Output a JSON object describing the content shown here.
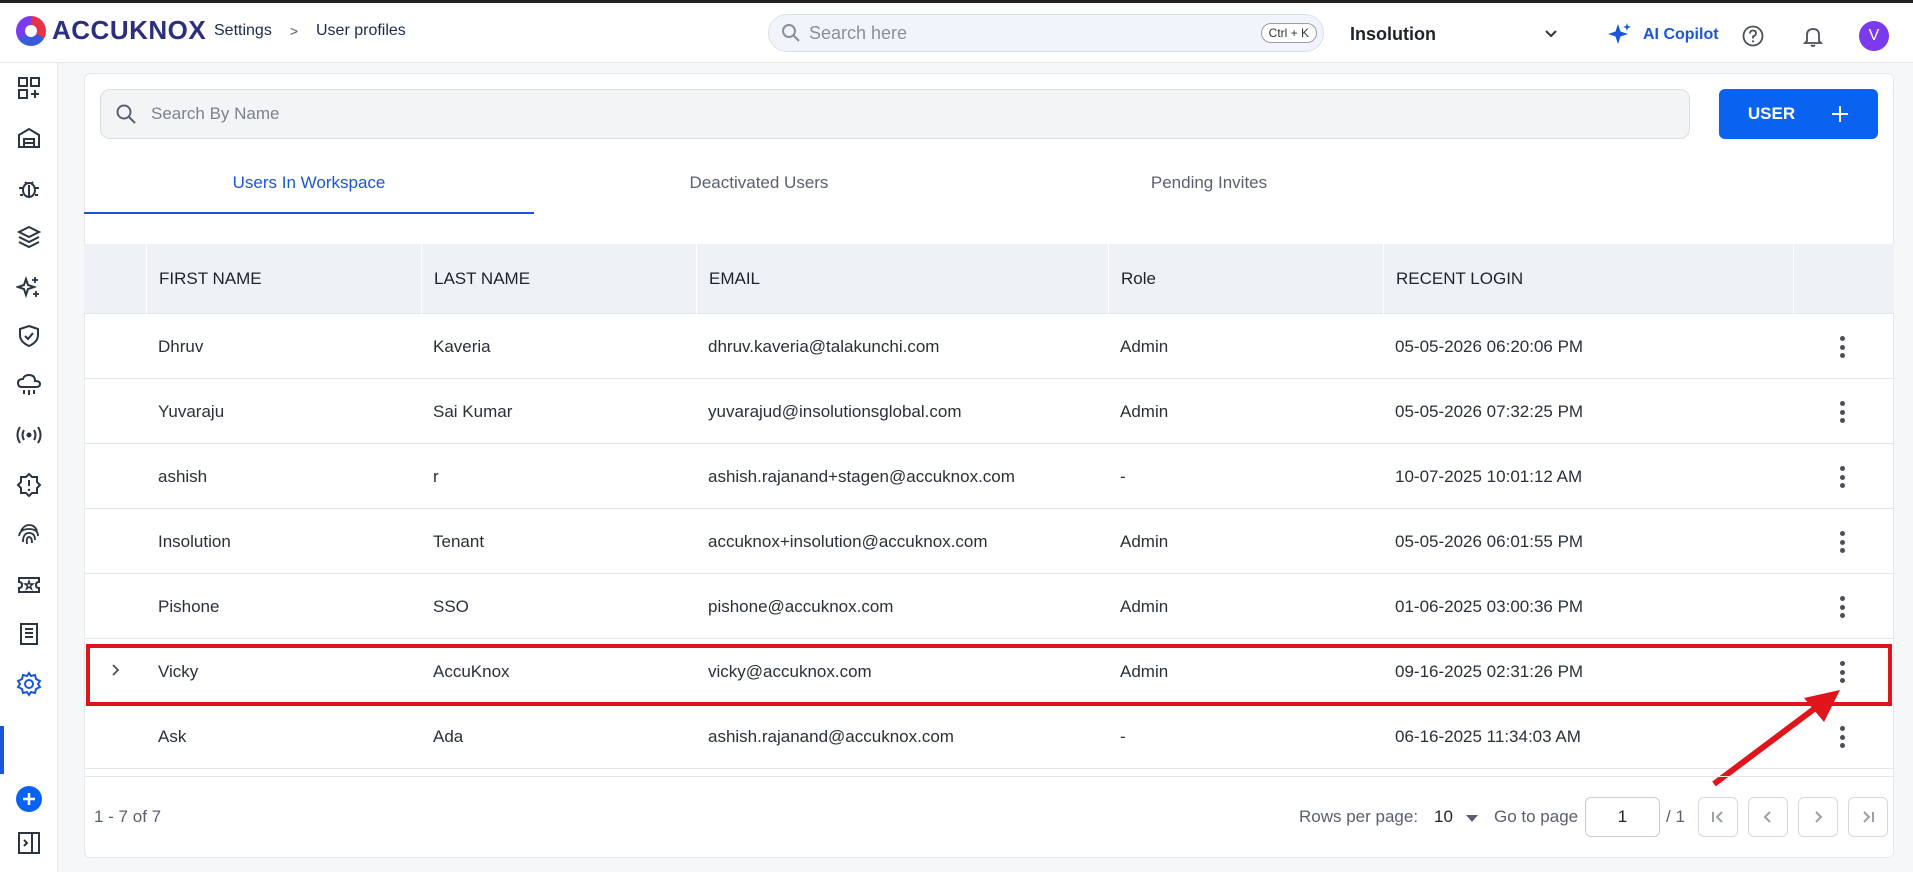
{
  "brand": {
    "name": "ACCUKNOX"
  },
  "breadcrumb": {
    "items": [
      "Settings",
      "User profiles"
    ],
    "separator": ">"
  },
  "topbar": {
    "search_placeholder": "Search here",
    "shortcut": "Ctrl + K",
    "workspace": "Insolution",
    "copilot_label": "AI Copilot",
    "avatar_initial": "V"
  },
  "sidebar": {
    "icons": [
      "dashboard-icon",
      "inventory-icon",
      "issues-icon",
      "layers-icon",
      "ai-icon",
      "compliance-icon",
      "cloud-icon",
      "runtime-icon",
      "alerts-icon",
      "identity-icon",
      "tickets-icon",
      "reports-icon",
      "settings-icon",
      "add-icon",
      "collapse-icon"
    ],
    "active": "settings-icon"
  },
  "main": {
    "search_placeholder": "Search By Name",
    "add_user_label": "USER",
    "tabs": [
      {
        "label": "Users In Workspace",
        "active": true
      },
      {
        "label": "Deactivated Users",
        "active": false
      },
      {
        "label": "Pending Invites",
        "active": false
      }
    ]
  },
  "table": {
    "columns": [
      "FIRST NAME",
      "LAST NAME",
      "EMAIL",
      "Role",
      "RECENT LOGIN"
    ],
    "rows": [
      {
        "first": "Dhruv",
        "last": "Kaveria",
        "email": "dhruv.kaveria@talakunchi.com",
        "role": "Admin",
        "login": "05-05-2026 06:20:06 PM"
      },
      {
        "first": "Yuvaraju",
        "last": "Sai Kumar",
        "email": "yuvarajud@insolutionsglobal.com",
        "role": "Admin",
        "login": "05-05-2026 07:32:25 PM"
      },
      {
        "first": "ashish",
        "last": "r",
        "email": "ashish.rajanand+stagen@accuknox.com",
        "role": "-",
        "login": "10-07-2025 10:01:12 AM"
      },
      {
        "first": "Insolution",
        "last": "Tenant",
        "email": "accuknox+insolution@accuknox.com",
        "role": "Admin",
        "login": "05-05-2026 06:01:55 PM"
      },
      {
        "first": "Pishone",
        "last": "SSO",
        "email": "pishone@accuknox.com",
        "role": "Admin",
        "login": "01-06-2025 03:00:36 PM"
      },
      {
        "first": "Vicky",
        "last": "AccuKnox",
        "email": "vicky@accuknox.com",
        "role": "Admin",
        "login": "09-16-2025 02:31:26 PM"
      },
      {
        "first": "Ask",
        "last": "Ada",
        "email": "ashish.rajanand@accuknox.com",
        "role": "-",
        "login": "06-16-2025 11:34:03 AM"
      }
    ]
  },
  "pagination": {
    "range": "1 - 7 of 7",
    "rows_per_page_label": "Rows per page:",
    "rows_per_page": "10",
    "goto_label": "Go to page",
    "page": "1",
    "total": "/ 1"
  },
  "annotation": {
    "color": "#e0141b"
  }
}
